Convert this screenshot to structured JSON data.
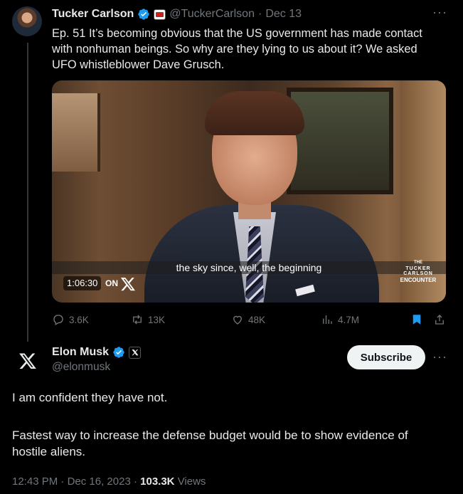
{
  "original_tweet": {
    "author_name": "Tucker Carlson",
    "author_handle": "@TuckerCarlson",
    "separator": "·",
    "date": "Dec 13",
    "text": "Ep. 51  It’s becoming obvious that the US government has made contact with nonhuman beings. So why are they lying to us about it? We asked UFO whistleblower Dave Grusch.",
    "video": {
      "caption": "the sky since, well, the beginning",
      "timestamp": "1:06:30",
      "on_label": "ON",
      "brand_small": "THE",
      "brand_arc": "TUCKER CARLSON",
      "brand_name": "ENCOUNTER"
    },
    "actions": {
      "replies": "3.6K",
      "reposts": "13K",
      "likes": "48K",
      "views": "4.7M"
    },
    "colors": {
      "verified": "#1d9bf0",
      "bookmark": "#1d9bf0"
    }
  },
  "reply_tweet": {
    "author_name": "Elon Musk",
    "author_handle": "@elonmusk",
    "subscribe_label": "Subscribe",
    "line1": "I am confident they have not.",
    "line2": "Fastest way to increase the defense budget would be to show evidence of hostile aliens.",
    "time": "12:43 PM",
    "separator": "·",
    "date": "Dec 16, 2023",
    "views_count": "103.3K",
    "views_label": "Views"
  }
}
